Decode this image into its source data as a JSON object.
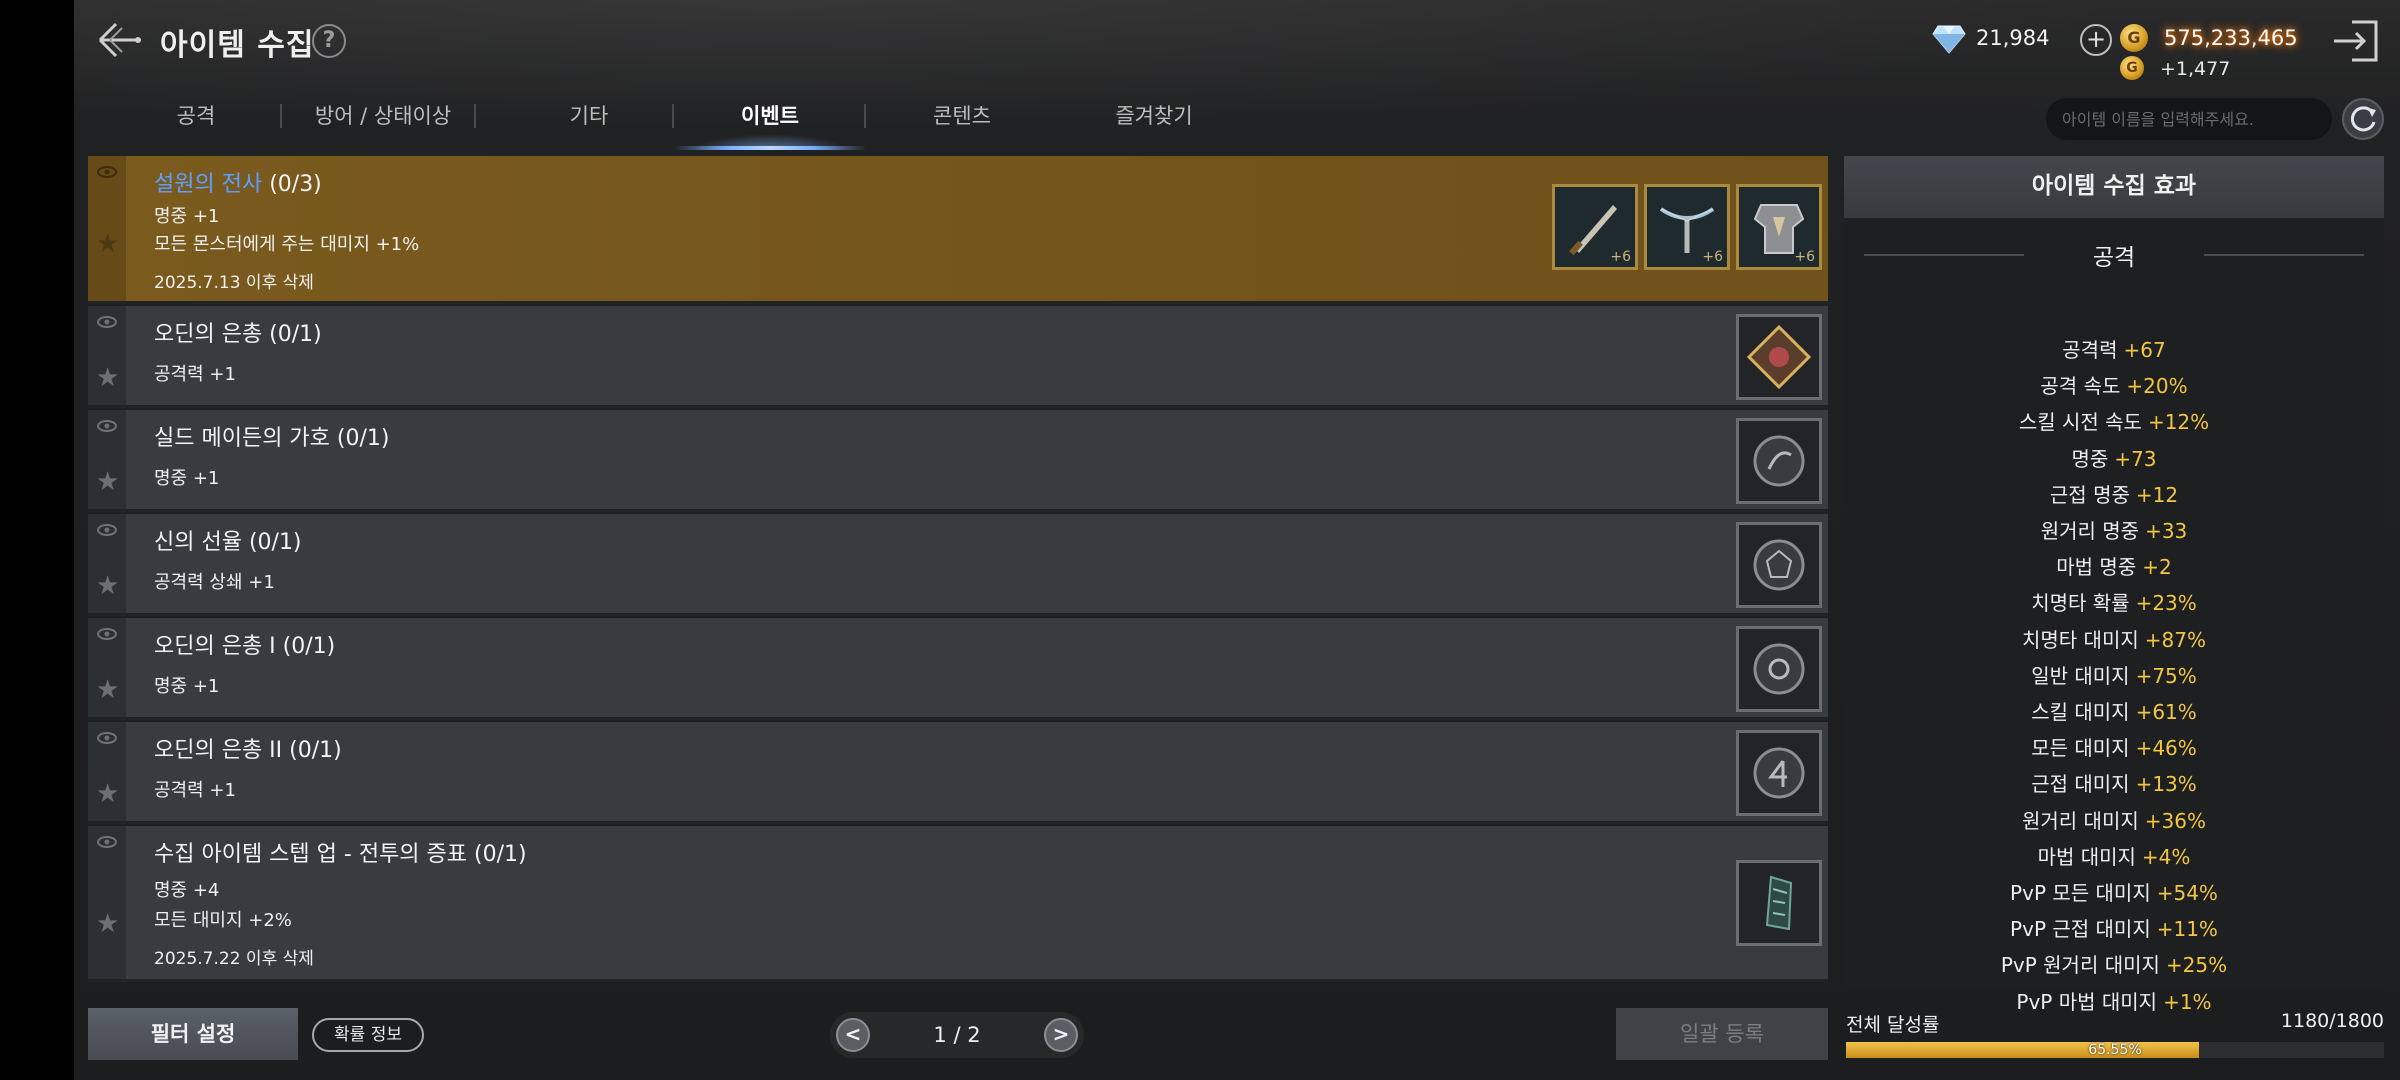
{
  "header": {
    "title": "아이템 수집",
    "help_label": "?",
    "diamond_amount": "21,984",
    "diamond_plus": "+",
    "gold_amount": "575,233,465",
    "gold_sub": "+1,477",
    "gold_symbol": "G"
  },
  "tabs": [
    {
      "label": "공격",
      "active": false
    },
    {
      "label": "방어 / 상태이상",
      "active": false
    },
    {
      "label": "기타",
      "active": false
    },
    {
      "label": "이벤트",
      "active": true
    },
    {
      "label": "콘텐츠",
      "active": false
    },
    {
      "label": "즐겨찾기",
      "active": false
    }
  ],
  "search": {
    "placeholder": "아이템 이름을 입력해주세요."
  },
  "items": [
    {
      "name_highlight": "설원의 전사",
      "name": " (0/3)",
      "lines": [
        "명중 +1",
        "모든 몬스터에게 주는 대미지 +1%"
      ],
      "date": "2025.7.13 이후 삭제",
      "slot_levels": [
        "+6",
        "+6",
        "+6"
      ]
    },
    {
      "name": "오딘의 은총 (0/1)",
      "lines": [
        "공격력 +1"
      ]
    },
    {
      "name": "실드 메이든의 가호 (0/1)",
      "lines": [
        "명중 +1"
      ]
    },
    {
      "name": "신의 선율 (0/1)",
      "lines": [
        "공격력 상쇄 +1"
      ]
    },
    {
      "name": "오딘의 은총 I  (0/1)",
      "lines": [
        "명중 +1"
      ]
    },
    {
      "name": "오딘의 은총 II  (0/1)",
      "lines": [
        "공격력 +1"
      ]
    },
    {
      "name": "수집 아이템 스텝 업 - 전투의 증표 (0/1)",
      "lines": [
        "명중 +4",
        "모든 대미지 +2%"
      ],
      "date": "2025.7.22 이후 삭제"
    }
  ],
  "panel": {
    "title": "아이템 수집 효과",
    "section": "공격",
    "stats": [
      {
        "label": "공격력",
        "value": "+67"
      },
      {
        "label": "공격 속도",
        "value": "+20%"
      },
      {
        "label": "스킬 시전 속도",
        "value": "+12%"
      },
      {
        "label": "명중",
        "value": "+73"
      },
      {
        "label": "근접 명중",
        "value": "+12"
      },
      {
        "label": "원거리 명중",
        "value": "+33"
      },
      {
        "label": "마법 명중",
        "value": "+2"
      },
      {
        "label": "치명타 확률",
        "value": "+23%"
      },
      {
        "label": "치명타 대미지",
        "value": "+87%"
      },
      {
        "label": "일반 대미지",
        "value": "+75%"
      },
      {
        "label": "스킬 대미지",
        "value": "+61%"
      },
      {
        "label": "모든 대미지",
        "value": "+46%"
      },
      {
        "label": "근접 대미지",
        "value": "+13%"
      },
      {
        "label": "원거리 대미지",
        "value": "+36%"
      },
      {
        "label": "마법 대미지",
        "value": "+4%"
      },
      {
        "label": "PvP 모든 대미지",
        "value": "+54%"
      },
      {
        "label": "PvP 근접 대미지",
        "value": "+11%"
      },
      {
        "label": "PvP 원거리 대미지",
        "value": "+25%"
      },
      {
        "label": "PvP 마법 대미지",
        "value": "+1%"
      }
    ]
  },
  "footer": {
    "filter_label": "필터 설정",
    "prob_label": "확률 정보",
    "page_text": "1 / 2",
    "prev_label": "<",
    "next_label": ">",
    "register_label": "일괄 등록",
    "progress_label": "전체 달성률",
    "progress_count": "1180/1800",
    "progress_pct": "65.55%",
    "progress_fraction": 0.6555
  },
  "colors": {
    "accent_gold": "#f2c641",
    "highlight_row": "#7a5a1d",
    "name_blue": "#5ea0ff"
  }
}
